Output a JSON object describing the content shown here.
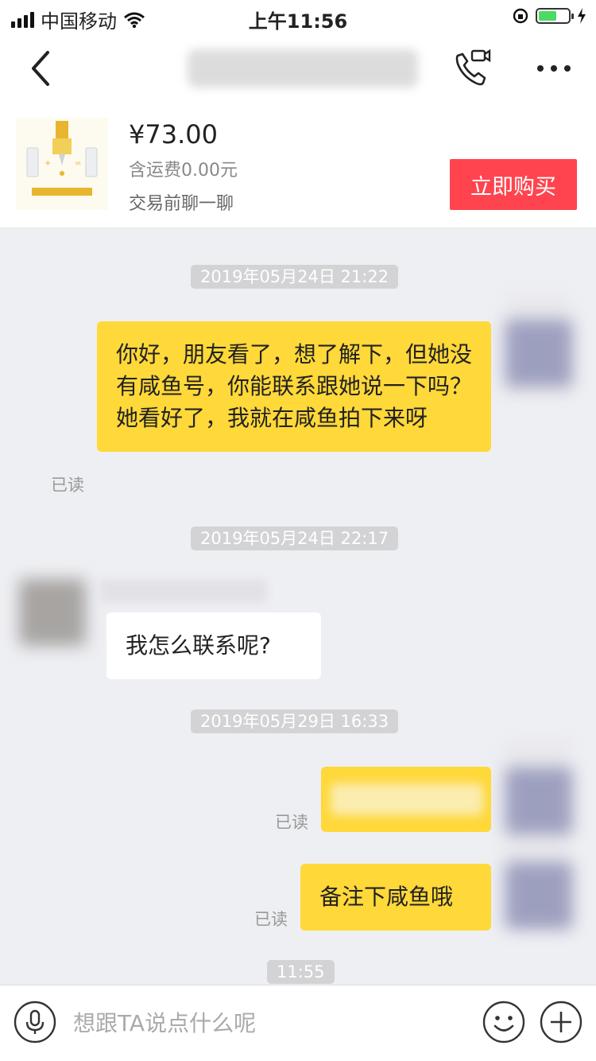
{
  "status_bar": {
    "carrier": "中国移动",
    "time": "上午11:56"
  },
  "product": {
    "price": "¥73.00",
    "shipping": "含运费0.00元",
    "chat_note": "交易前聊一聊",
    "buy_label": "立即购买"
  },
  "messages": {
    "ts1": "2019年05月24日 21:22",
    "msg1": "你好，朋友看了，想了解下，但她没有咸鱼号，你能联系跟她说一下吗？她看好了，我就在咸鱼拍下来呀",
    "ts2": "2019年05月24日 22:17",
    "msg2": "我怎么联系呢?",
    "ts3": "2019年05月29日 16:33",
    "msg4": "备注下咸鱼哦",
    "ts4": "11:55",
    "read_label": "已读"
  },
  "input": {
    "placeholder": "想跟TA说点什么呢"
  },
  "icons": {
    "back": "back-chevron-icon",
    "call": "phone-video-icon",
    "more": "more-dots-icon",
    "mic": "microphone-icon",
    "emoji": "emoji-icon",
    "plus": "plus-icon"
  },
  "colors": {
    "my_bubble": "#ffd839",
    "buy_button": "#ff444f",
    "background": "#eeeff3"
  }
}
